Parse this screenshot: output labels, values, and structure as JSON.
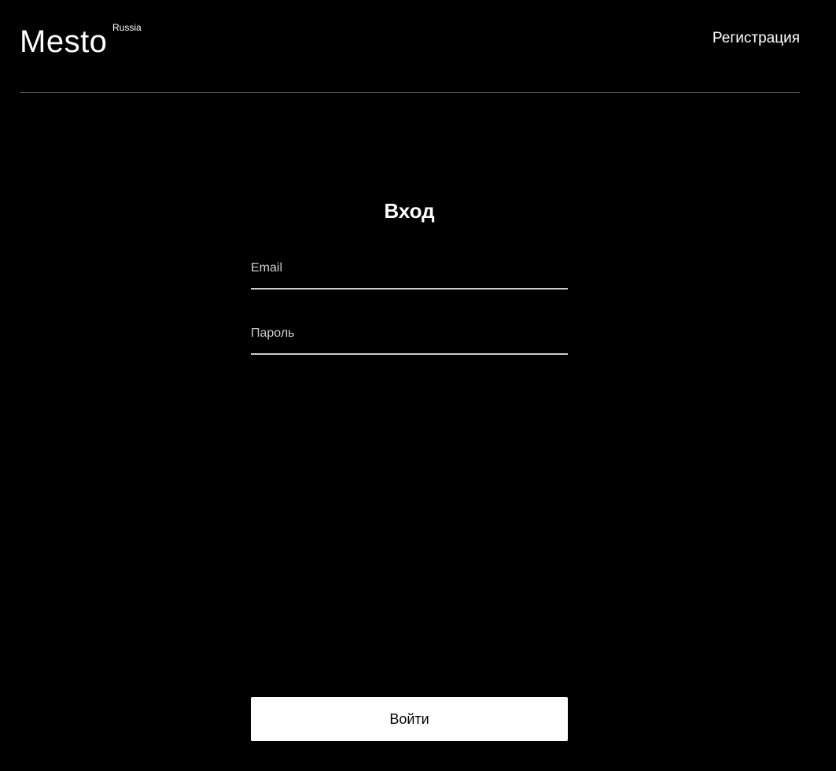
{
  "header": {
    "logo_text": "Mesto",
    "logo_superscript": "Russia",
    "nav_link": "Регистрация"
  },
  "form": {
    "title": "Вход",
    "email_placeholder": "Email",
    "password_placeholder": "Пароль",
    "submit_label": "Войти"
  },
  "colors": {
    "background": "#000000",
    "text": "#ffffff",
    "divider": "#545454",
    "button_bg": "#ffffff"
  }
}
